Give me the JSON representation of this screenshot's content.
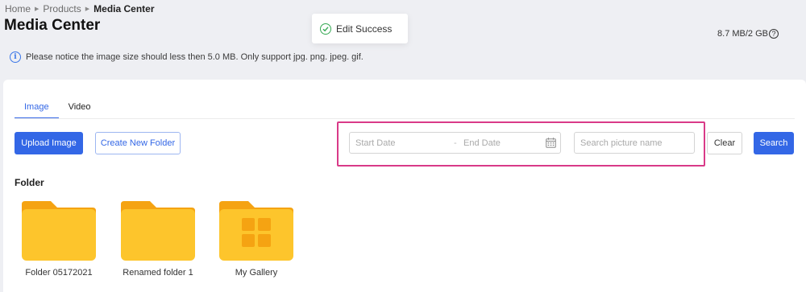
{
  "breadcrumb": {
    "items": [
      "Home",
      "Products"
    ],
    "current": "Media Center"
  },
  "page": {
    "title": "Media Center",
    "storage": "8.7 MB/2 GB",
    "notice": "Please notice the image size should less then 5.0 MB. Only support jpg. png. jpeg. gif."
  },
  "toast": {
    "message": "Edit Success"
  },
  "tabs": [
    {
      "label": "Image",
      "active": true
    },
    {
      "label": "Video",
      "active": false
    }
  ],
  "toolbar": {
    "upload_label": "Upload Image",
    "new_folder_label": "Create New Folder",
    "start_date_placeholder": "Start Date",
    "date_separator": "-",
    "end_date_placeholder": "End Date",
    "search_placeholder": "Search picture name",
    "clear_label": "Clear",
    "search_label": "Search"
  },
  "folders": {
    "heading": "Folder",
    "items": [
      {
        "name": "Folder 05172021",
        "icon": "folder-icon"
      },
      {
        "name": "Renamed folder 1",
        "icon": "folder-icon"
      },
      {
        "name": "My Gallery",
        "icon": "gallery-folder-icon"
      }
    ]
  },
  "colors": {
    "accent": "#3367e6",
    "highlight": "#d93a88",
    "folder": "#fdc52c",
    "folder_tab": "#f5a312",
    "success": "#35a853"
  }
}
